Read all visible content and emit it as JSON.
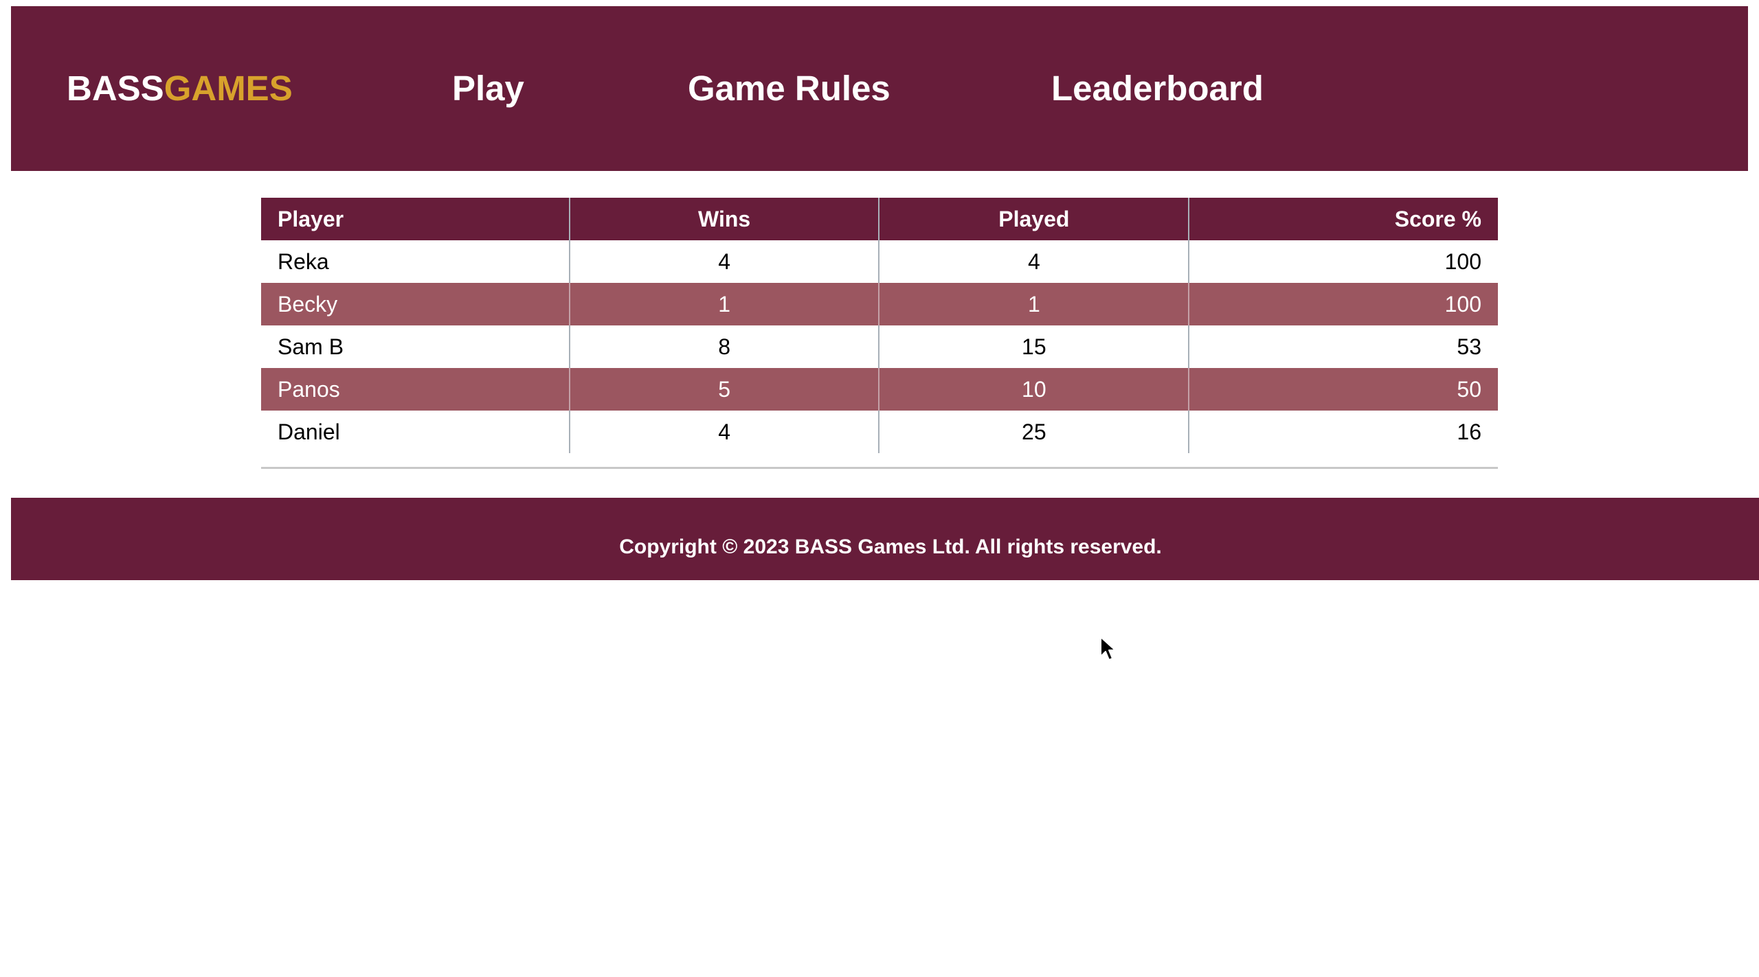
{
  "header": {
    "logo_part1": "BASS",
    "logo_part2": "GAMES",
    "nav": {
      "play": "Play",
      "rules": "Game Rules",
      "leaderboard": "Leaderboard"
    }
  },
  "leaderboard": {
    "columns": [
      "Player",
      "Wins",
      "Played",
      "Score %"
    ],
    "rows": [
      {
        "player": "Reka",
        "wins": "4",
        "played": "4",
        "score": "100"
      },
      {
        "player": "Becky",
        "wins": "1",
        "played": "1",
        "score": "100"
      },
      {
        "player": "Sam B",
        "wins": "8",
        "played": "15",
        "score": "53"
      },
      {
        "player": "Panos",
        "wins": "5",
        "played": "10",
        "score": "50"
      },
      {
        "player": "Daniel",
        "wins": "4",
        "played": "25",
        "score": "16"
      }
    ]
  },
  "footer": {
    "copyright": "Copyright © 2023 BASS Games Ltd. All rights reserved."
  },
  "colors": {
    "brand": "#671d3a",
    "accent": "#d8a22c",
    "row_alt": "#9b5660"
  },
  "cursor_icon": "mouse-pointer-icon"
}
